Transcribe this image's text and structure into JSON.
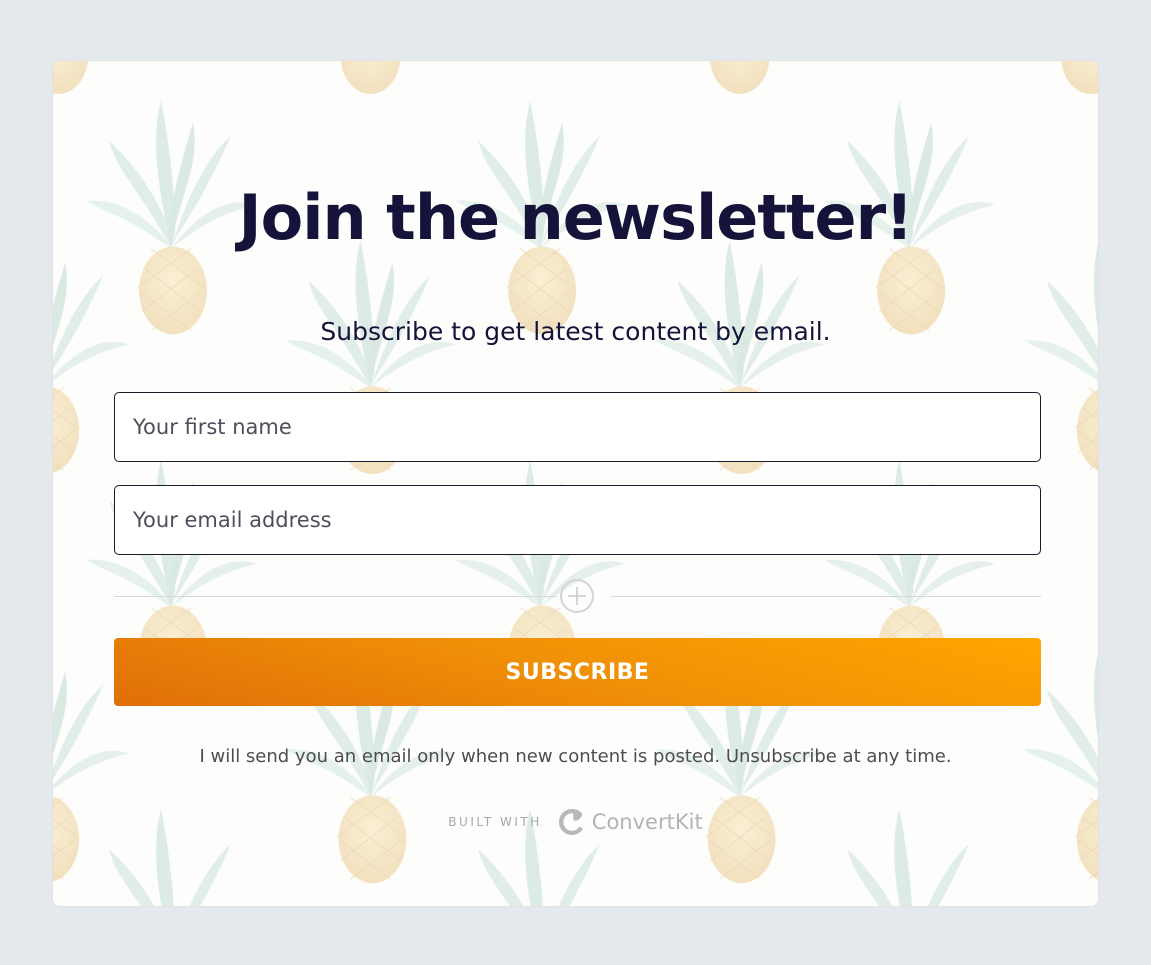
{
  "form": {
    "title": "Join the newsletter!",
    "subtitle": "Subscribe to get latest content by email.",
    "first_name_placeholder": "Your first name",
    "email_placeholder": "Your email address",
    "subscribe_label": "SUBSCRIBE",
    "disclaimer": "I will send you an email only when new content is posted. Unsubscribe at any time.",
    "built_with_label": "BUILT WITH",
    "brand_name": "ConvertKit"
  },
  "icons": {
    "expand": "plus-circle-icon",
    "brand_logo": "convertkit-logo-icon",
    "background": "pineapple-pattern"
  },
  "colors": {
    "page_background": "#e4e9ee",
    "card_background": "#fdfdfb",
    "heading": "#15133a",
    "button_start": "#e06f08",
    "button_end": "#fea600",
    "button_text": "#ffffff"
  }
}
